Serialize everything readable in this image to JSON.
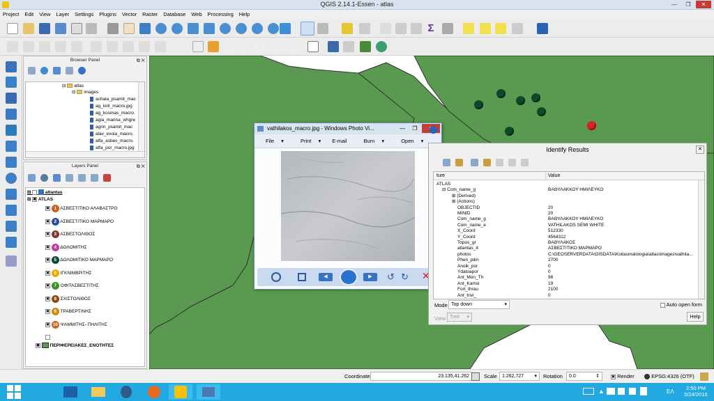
{
  "window": {
    "title": "QGIS 2.14.1-Essen - atlas"
  },
  "menubar": [
    "Project",
    "Edit",
    "View",
    "Layer",
    "Settings",
    "Plugins",
    "Vector",
    "Raster",
    "Database",
    "Web",
    "Processing",
    "Help"
  ],
  "browser_panel": {
    "title": "Browser Panel",
    "items": [
      "atlas",
      "images",
      "achaia_psamit_mac",
      "ag_kiril_macro.jpg",
      "ag_kosmas_macro.",
      "agia_marina_whgre",
      "agrin_psamit_mac",
      "alav_evoia_macro.",
      "alfa_asbes_macro.",
      "alfa_por_macro.jpg"
    ]
  },
  "layers_panel": {
    "title": "Layers Panel",
    "root": "atlantas",
    "group": "ATLAS",
    "items": [
      {
        "n": "1",
        "label": "ΑΣΒΕΣΤΙΤΙΚΟ ΑΛΑΒΑΣΤΡΟ",
        "color": "#c8621e"
      },
      {
        "n": "2",
        "label": "ΑΣΒΕΣΤΙΤΙΚΟ ΜΑΡΜΑΡΟ",
        "color": "#2a4f9a"
      },
      {
        "n": "3",
        "label": "ΑΣΒΕΣΤΟΛΙΘΟΣ",
        "color": "#7a3b2e"
      },
      {
        "n": "4",
        "label": "ΔΟΛΟΜΙΤΗΣ",
        "color": "#c03b9b"
      },
      {
        "n": "5",
        "label": "ΔΟΛΟΜΙΤΙΚΟ ΜΑΡΜΑΡΟ",
        "color": "#0d4a2a"
      },
      {
        "n": "6",
        "label": "ΙΓΚΝΙΜΒΡΙΤΗΣ",
        "color": "#f0a800"
      },
      {
        "n": "7",
        "label": "ΟΦΙΤΑΣΒΕΣΤΙΤΗΣ",
        "color": "#3f8f2a"
      },
      {
        "n": "8",
        "label": "ΣΧΙΣΤΟΛΙΘΟΣ",
        "color": "#8a4b1a"
      },
      {
        "n": "9",
        "label": "ΤΡΑΒΕΡΤΙΝΗΣ",
        "color": "#d08a12"
      },
      {
        "n": "10",
        "label": "ΨΑΜΜΙΤΗΣ- ΠΗΛΙΤΗΣ",
        "color": "#c8621e"
      }
    ],
    "empty_label": "·",
    "regions": "ΠΕΡΙΦΕΡΕΙΑΚΕΣ_ΕΝΟΤΗΤΕΣ"
  },
  "photo_viewer": {
    "title": "vathilakos_macro.jpg - Windows Photo Vi...",
    "menu": [
      "File",
      "Print",
      "E-mail",
      "Burn",
      "Open"
    ]
  },
  "identify": {
    "title": "Identify Results",
    "col_feature": "ture",
    "col_value": "Value",
    "rows": [
      {
        "f": "ATLAS",
        "v": "",
        "i": 0
      },
      {
        "f": "⊟  Com_name_g",
        "v": "ΒΑΘΥΛΑΚΚΟΥ ΗΜΙΛΕΥΚΟ",
        "i": 1
      },
      {
        "f": "⊞  (Derived)",
        "v": "",
        "i": 2
      },
      {
        "f": "⊞  (Actions)",
        "v": "",
        "i": 2
      },
      {
        "f": "OBJECTID",
        "v": "20",
        "i": 3
      },
      {
        "f": "MINID",
        "v": "20",
        "i": 3
      },
      {
        "f": "Com_name_g",
        "v": "ΒΑΘΥΛΑΚΚΟΥ ΗΜΙΛΕΥΚΟ",
        "i": 3
      },
      {
        "f": "Com_name_e",
        "v": "VATHILAKOS SEMI WHITE",
        "i": 3
      },
      {
        "f": "X_Coord",
        "v": "512330",
        "i": 3
      },
      {
        "f": "Y_Coord",
        "v": "4564312",
        "i": 3
      },
      {
        "f": "Topos_gr",
        "v": "ΒΑΘΥΛΑΚΟΣ",
        "i": 3
      },
      {
        "f": "atlantas_4",
        "v": "ΑΣΒΕΣΤΙΤΙΚΟ ΜΑΡΜΑΡΟ",
        "i": 3
      },
      {
        "f": "photos",
        "v": "C:\\GEOSERVERDATA\\GISDATA\\Koitasmatologia\\atlas\\images\\vathila...",
        "i": 3
      },
      {
        "f": "Phen_pikn",
        "v": "2700",
        "i": 3
      },
      {
        "f": "Anoik_por",
        "v": "0",
        "i": 3
      },
      {
        "f": "Ydatoapor",
        "v": "0",
        "i": 3
      },
      {
        "f": "Ant_Mon_Th",
        "v": "98",
        "i": 3
      },
      {
        "f": "Ant_Kamsi",
        "v": "19",
        "i": 3
      },
      {
        "f": "Fort_thrau",
        "v": "2100",
        "i": 3
      },
      {
        "f": "Ant_trivi_",
        "v": "0",
        "i": 3
      }
    ],
    "mode_label": "Mode",
    "mode_value": "Top down",
    "auto_open": "Auto open form",
    "view_label": "View",
    "view_value": "Tree",
    "help": "Help"
  },
  "statusbar": {
    "coordinate_label": "Coordinate",
    "coordinate": "23.135,41.262",
    "scale_label": "Scale",
    "scale": "1:262,727",
    "rotation_label": "Rotation",
    "rotation": "0.0",
    "render": "Render",
    "crs": "EPSG:4326 (OTF)"
  },
  "taskbar": {
    "lang": "ΕΛ",
    "time": "2:50 PM",
    "date": "5/24/2016"
  }
}
